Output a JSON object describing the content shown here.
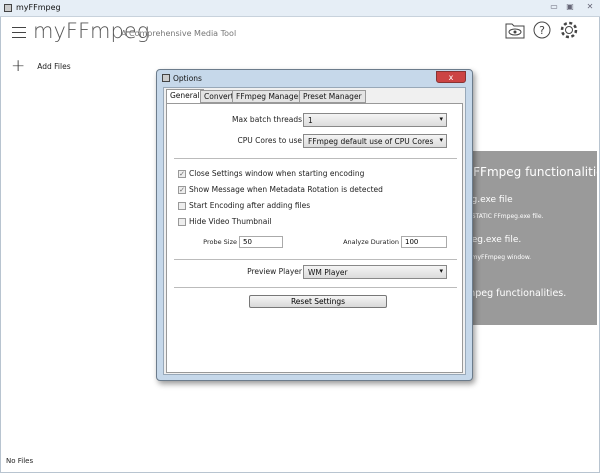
{
  "window": {
    "title": "myFFmpeg",
    "controls": [
      "minimize",
      "maximize",
      "close"
    ]
  },
  "header": {
    "app_name": "myFFmpeg",
    "subtitle": "A Comprehensive Media Tool",
    "icons": [
      "folder-eye-icon",
      "help-icon",
      "gear-icon"
    ]
  },
  "toolbar": {
    "add_files": "Add Files"
  },
  "background_panel": {
    "lines": [
      "l FFmpeg functionalitie",
      "eg.exe file",
      "d STATIC FFmpeg.exe file.",
      "peg.exe file.",
      "e myFFmpeg window.",
      "mpeg functionalities."
    ]
  },
  "status": {
    "text": "No Files"
  },
  "dialog": {
    "title": "Options",
    "close": "x",
    "tabs": [
      "General",
      "Convert",
      "FFmpeg Manager",
      "Preset Manager"
    ],
    "active_tab": "General",
    "max_batch_threads": {
      "label": "Max batch threads",
      "value": "1"
    },
    "cpu_cores": {
      "label": "CPU Cores to use",
      "value": "FFmpeg default use of CPU Cores"
    },
    "checkboxes": [
      {
        "label": "Close Settings window when starting encoding",
        "checked": true
      },
      {
        "label": "Show Message when Metadata Rotation is detected",
        "checked": true
      },
      {
        "label": "Start Encoding after adding files",
        "checked": false
      },
      {
        "label": "Hide Video Thumbnail",
        "checked": false
      }
    ],
    "probe_size": {
      "label": "Probe Size",
      "value": "50"
    },
    "analyze_duration": {
      "label": "Analyze Duration",
      "value": "100"
    },
    "preview_player": {
      "label": "Preview Player",
      "value": "WM Player"
    },
    "reset": "Reset Settings"
  }
}
